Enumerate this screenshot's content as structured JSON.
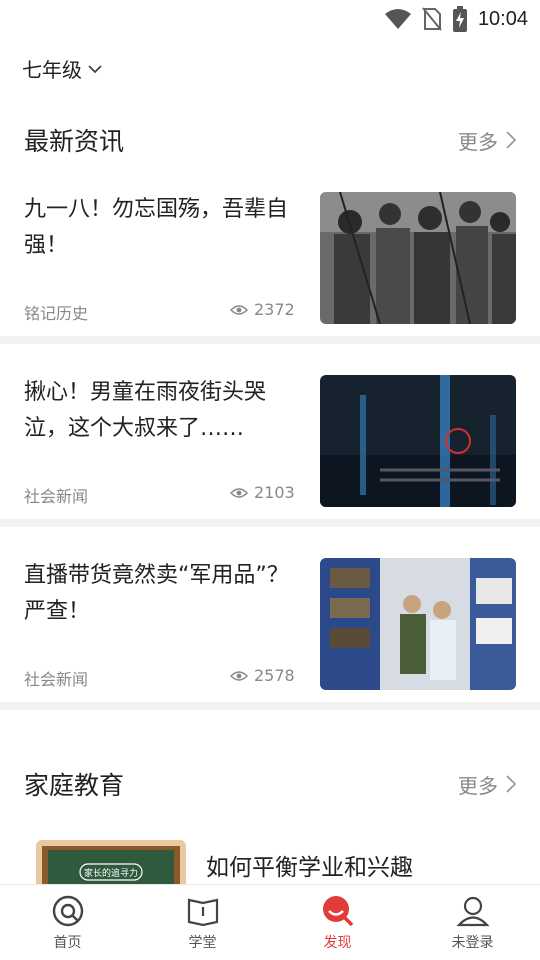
{
  "status_bar": {
    "time": "10:04",
    "icons": [
      "wifi-icon",
      "no-sim-icon",
      "battery-charging-icon"
    ]
  },
  "grade_selector": {
    "label": "七年级",
    "icon": "chevron-down-icon"
  },
  "latest_news": {
    "title": "最新资讯",
    "more_label": "更多",
    "items": [
      {
        "title": "九一八！勿忘国殇，吾辈自强！",
        "source": "铭记历史",
        "views": "2372"
      },
      {
        "title": "揪心！男童在雨夜街头哭泣，这个大叔来了……",
        "source": "社会新闻",
        "views": "2103"
      },
      {
        "title": "直播带货竟然卖“军用品”？严查！",
        "source": "社会新闻",
        "views": "2578"
      }
    ]
  },
  "family_education": {
    "title": "家庭教育",
    "more_label": "更多",
    "first_item": {
      "title": "如何平衡学业和兴趣",
      "thumb_caption": "家长的追寻力"
    }
  },
  "tab_bar": {
    "tabs": [
      {
        "label": "首页",
        "icon": "home-icon"
      },
      {
        "label": "学堂",
        "icon": "book-icon"
      },
      {
        "label": "发现",
        "icon": "discover-icon",
        "active": true
      },
      {
        "label": "未登录",
        "icon": "user-icon"
      }
    ]
  },
  "colors": {
    "accent": "#e03c3c",
    "text": "#222222",
    "muted": "#888888",
    "divider": "#f2f2f2"
  }
}
